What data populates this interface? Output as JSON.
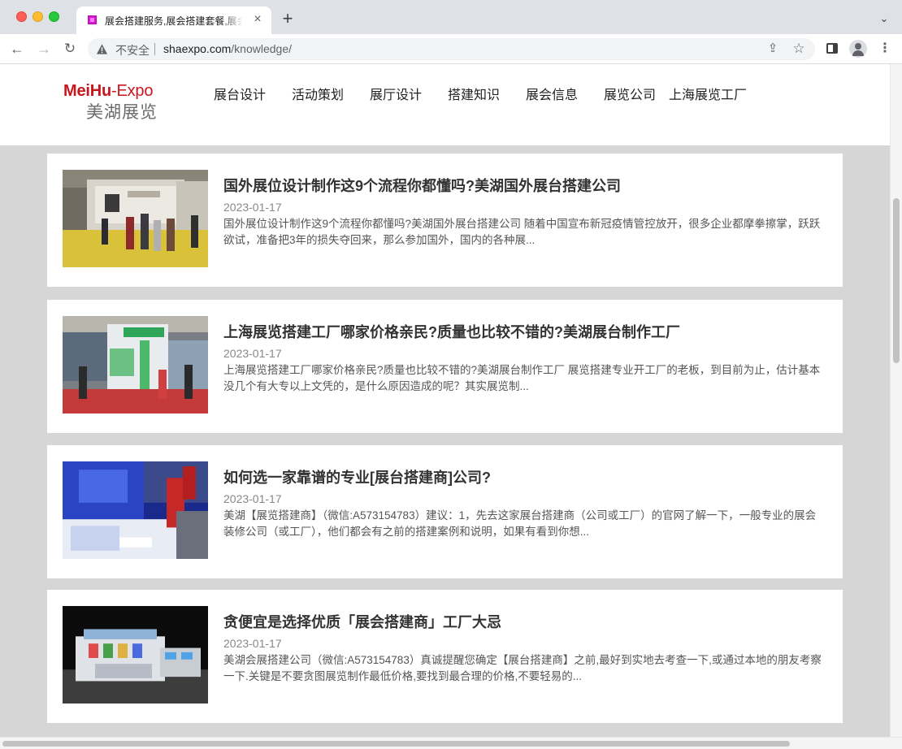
{
  "browser": {
    "tab_title": "展会搭建服务,展会搭建套餐,展会搭建公司",
    "tab_close": "×",
    "new_tab": "+",
    "tab_menu": "⌄",
    "back": "←",
    "forward": "→",
    "reload": "↻",
    "insecure_label": "不安全",
    "url_domain": "shaexpo.com",
    "url_path": "/knowledge/",
    "share": "⇪",
    "star": "☆",
    "menu": "⋮"
  },
  "site": {
    "logo_en_part1": "MeiHu",
    "logo_en_part2": "-Expo",
    "logo_cn": "美湖展览",
    "nav": [
      "展台设计",
      "活动策划",
      "展厅设计",
      "搭建知识",
      "展会信息",
      "展览公司",
      "上海展览工厂"
    ]
  },
  "articles": [
    {
      "title": "国外展位设计制作这9个流程你都懂吗?美湖国外展台搭建公司",
      "date": "2023-01-17",
      "excerpt": "国外展位设计制作这9个流程你都懂吗?美湖国外展台搭建公司 随着中国宣布新冠疫情管控放开，很多企业都摩拳擦掌，跃跃欲试，准备把3年的损失夺回来，那么参加国外，国内的各种展..."
    },
    {
      "title": "上海展览搭建工厂哪家价格亲民?质量也比较不错的?美湖展台制作工厂",
      "date": "2023-01-17",
      "excerpt": "上海展览搭建工厂哪家价格亲民?质量也比较不错的?美湖展台制作工厂 展览搭建专业开工厂的老板，到目前为止，估计基本没几个有大专以上文凭的，是什么原因造成的呢？其实展览制..."
    },
    {
      "title": "如何选一家靠谱的专业[展台搭建商]公司?",
      "date": "2023-01-17",
      "excerpt": "美湖【展览搭建商】（微信:A573154783）建议：1，先去这家展台搭建商（公司或工厂）的官网了解一下，一般专业的展会装修公司（或工厂），他们都会有之前的搭建案例和说明，如果有看到你想..."
    },
    {
      "title": "贪便宜是选择优质「展会搭建商」工厂大忌",
      "date": "2023-01-17",
      "excerpt": "美湖会展搭建公司（微信:A573154783）真诚提醒您确定【展台搭建商】之前,最好到实地去考查一下,或通过本地的朋友考察一下.关键是不要贪图展览制作最低价格,要找到最合理的价格,不要轻易的..."
    }
  ]
}
